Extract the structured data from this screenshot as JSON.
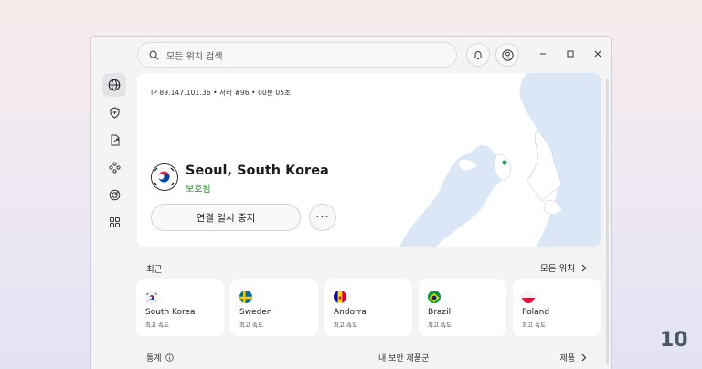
{
  "search": {
    "placeholder": "모든 위치 검색"
  },
  "connection": {
    "ip_line": "IP 89.147.101.36 • 서버 #96 • 00분 05초",
    "city": "Seoul, South Korea",
    "status": "보호됨",
    "pause_label": "연결 일시 중지",
    "more_label": "···"
  },
  "recent": {
    "title": "최근",
    "all_locations": "모든 위치",
    "items": [
      {
        "name": "South Korea",
        "speed": "최고 속도",
        "flag": "kr-flag-icon"
      },
      {
        "name": "Sweden",
        "speed": "최고 속도",
        "flag": "se-flag-icon"
      },
      {
        "name": "Andorra",
        "speed": "최고 속도",
        "flag": "ad-flag-icon"
      },
      {
        "name": "Brazil",
        "speed": "최고 속도",
        "flag": "br-flag-icon"
      },
      {
        "name": "Poland",
        "speed": "최고 속도",
        "flag": "pl-flag-icon"
      }
    ]
  },
  "bottom": {
    "stats": "통계",
    "products_section": "내 보안 제품군",
    "products": "제품"
  },
  "brand": {
    "watermark": "10"
  },
  "colors": {
    "protected_green": "#2d8a2d",
    "map_water": "#dbe7f7",
    "connected_dot": "#2f9a58"
  }
}
